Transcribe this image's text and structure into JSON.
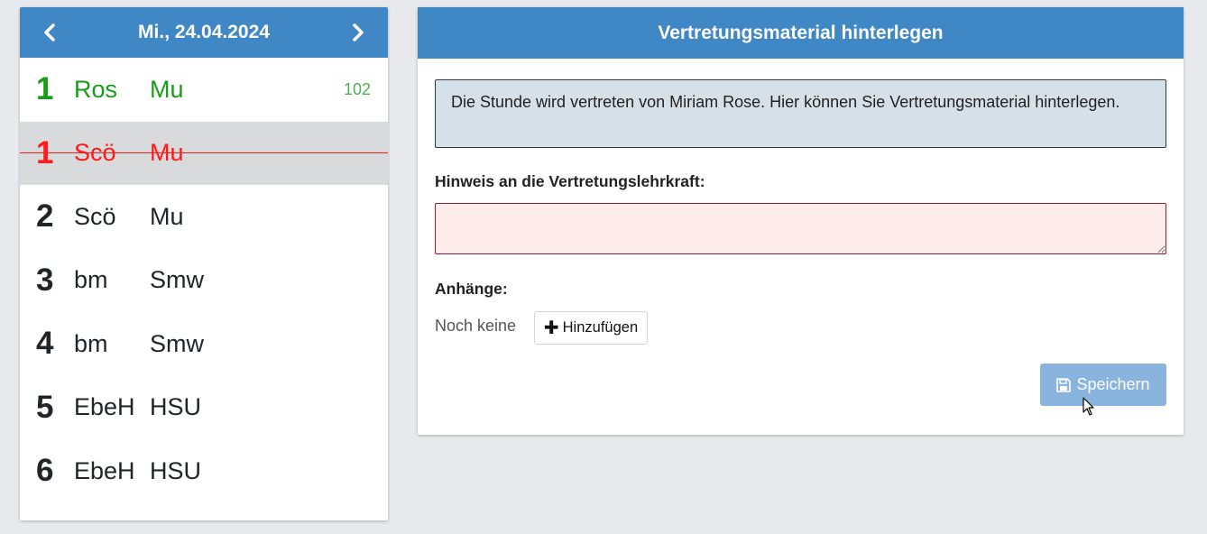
{
  "day": {
    "date": "Mi., 24.04.2024",
    "prev_icon": "chevron-left-icon",
    "next_icon": "chevron-right-icon",
    "lessons": [
      {
        "period": "1",
        "teacher": "Ros",
        "subject": "Mu",
        "room": "102",
        "status": "active"
      },
      {
        "period": "1",
        "teacher": "Scö",
        "subject": "Mu",
        "room": "",
        "status": "cancelled"
      },
      {
        "period": "2",
        "teacher": "Scö",
        "subject": "Mu",
        "room": "",
        "status": "normal"
      },
      {
        "period": "3",
        "teacher": "bm",
        "subject": "Smw",
        "room": "",
        "status": "normal"
      },
      {
        "period": "4",
        "teacher": "bm",
        "subject": "Smw",
        "room": "",
        "status": "normal"
      },
      {
        "period": "5",
        "teacher": "EbeH",
        "subject": "HSU",
        "room": "",
        "status": "normal"
      },
      {
        "period": "6",
        "teacher": "EbeH",
        "subject": "HSU",
        "room": "",
        "status": "normal"
      }
    ]
  },
  "material": {
    "title": "Vertretungsmaterial hinterlegen",
    "info": "Die Stunde wird vertreten von Miriam Rose. Hier können Sie Vertretungsmaterial hinterlegen.",
    "note_label": "Hinweis an die Vertretungslehrkraft:",
    "note_value": "",
    "attachments_label": "Anhänge:",
    "attachments_empty": "Noch keine",
    "add_label": "Hinzufügen",
    "add_icon": "plus-icon",
    "save_label": "Speichern",
    "save_icon": "floppy-disk-icon"
  },
  "colors": {
    "header": "#3f88c5",
    "active_lesson": "#1a9b1a",
    "cancelled_lesson": "#ff1a1a",
    "save_button": "#88b4dd",
    "note_border": "#9b1f2a"
  }
}
